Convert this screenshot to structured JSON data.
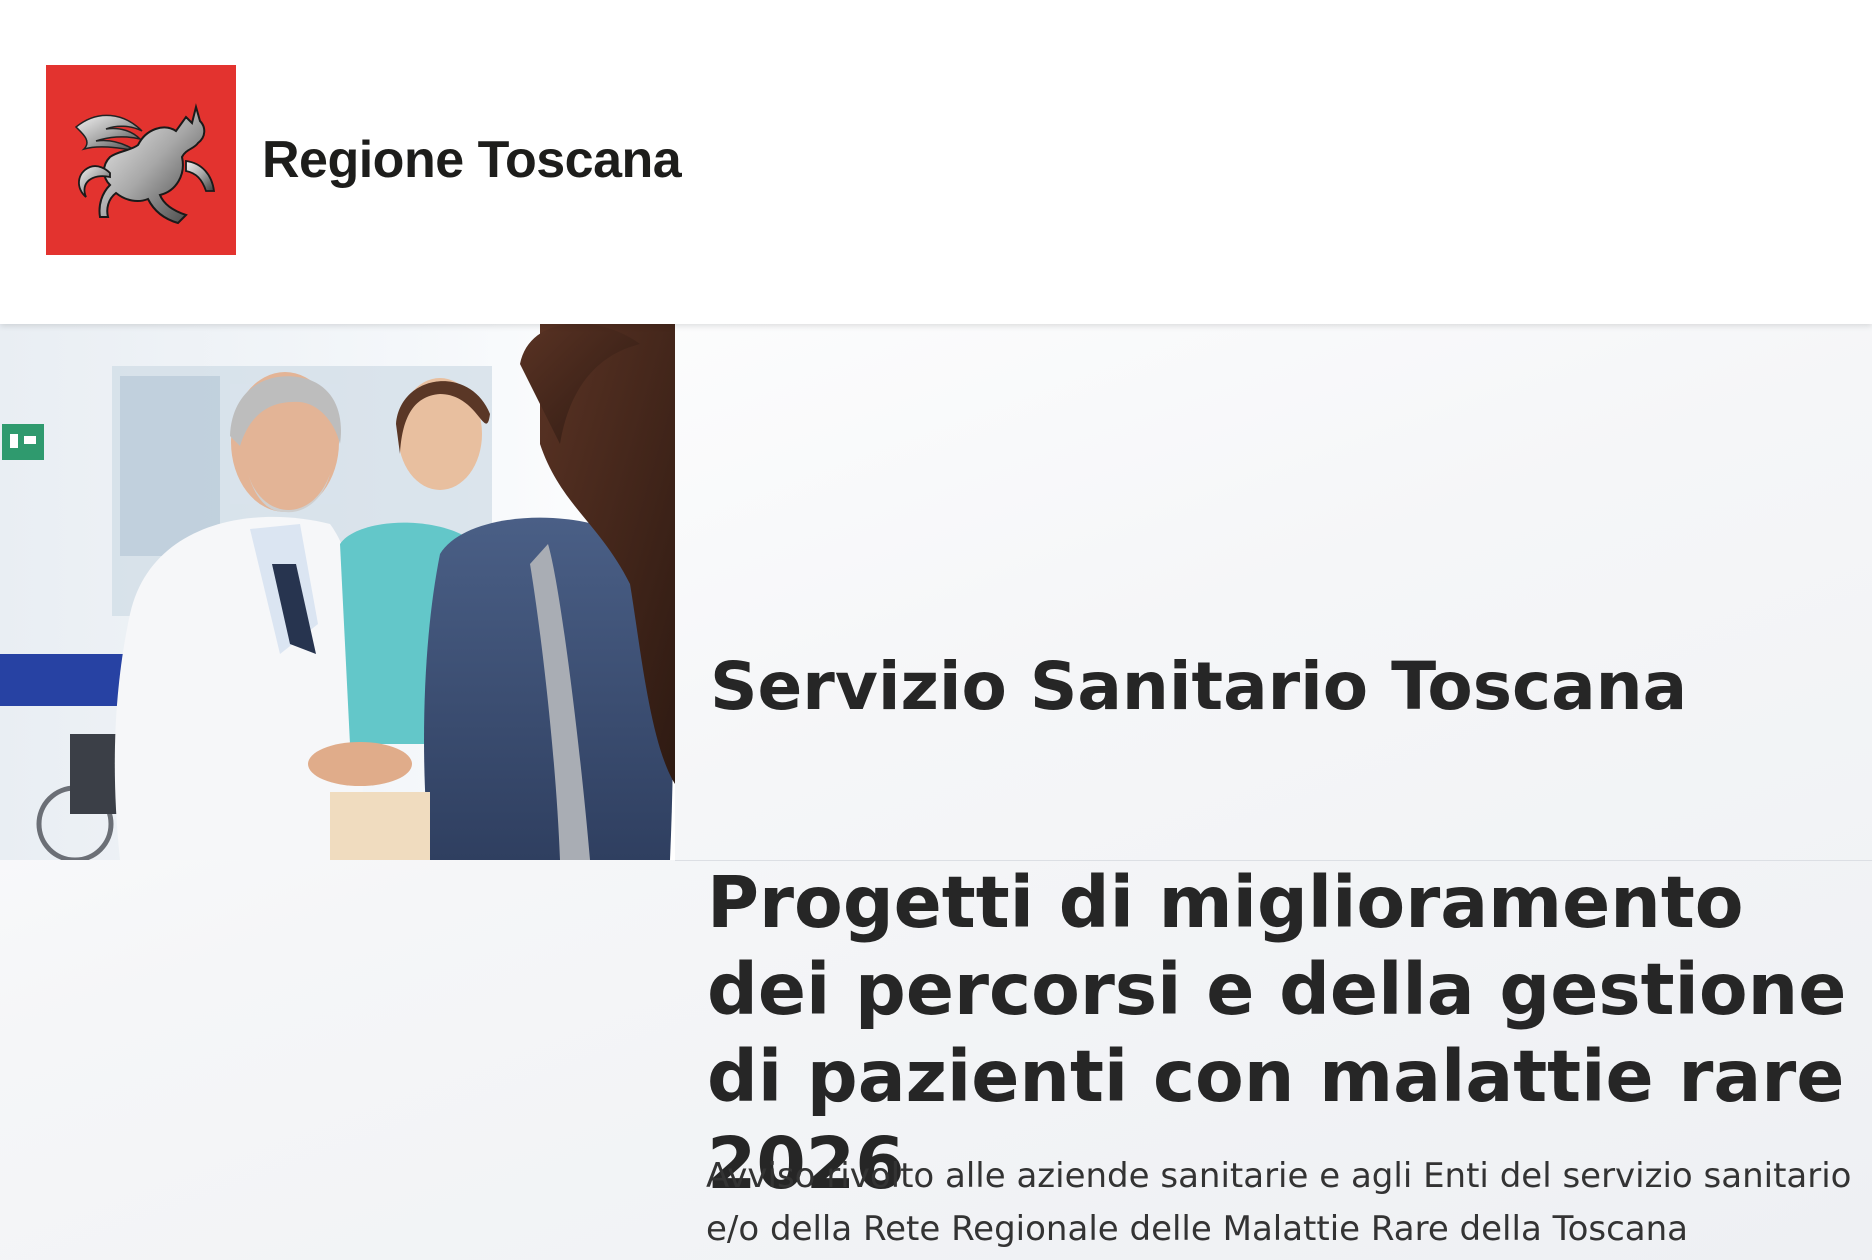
{
  "header": {
    "logo_icon": "pegasus-icon",
    "brand_name": "Regione Toscana"
  },
  "hero": {
    "image": "doctor-greeting-patient-photo",
    "section_title": "Servizio Sanitario Toscana",
    "page_title": "Progetti di miglioramento dei percorsi e della gestione di pazienti con malattie rare 2026",
    "subtitle": "Avviso rivolto alle aziende sanitarie e agli Enti del servizio sanitario e/o della Rete Regionale delle Malattie Rare della Toscana"
  },
  "colors": {
    "brand_red": "#e3332f",
    "text_dark": "#262626"
  }
}
